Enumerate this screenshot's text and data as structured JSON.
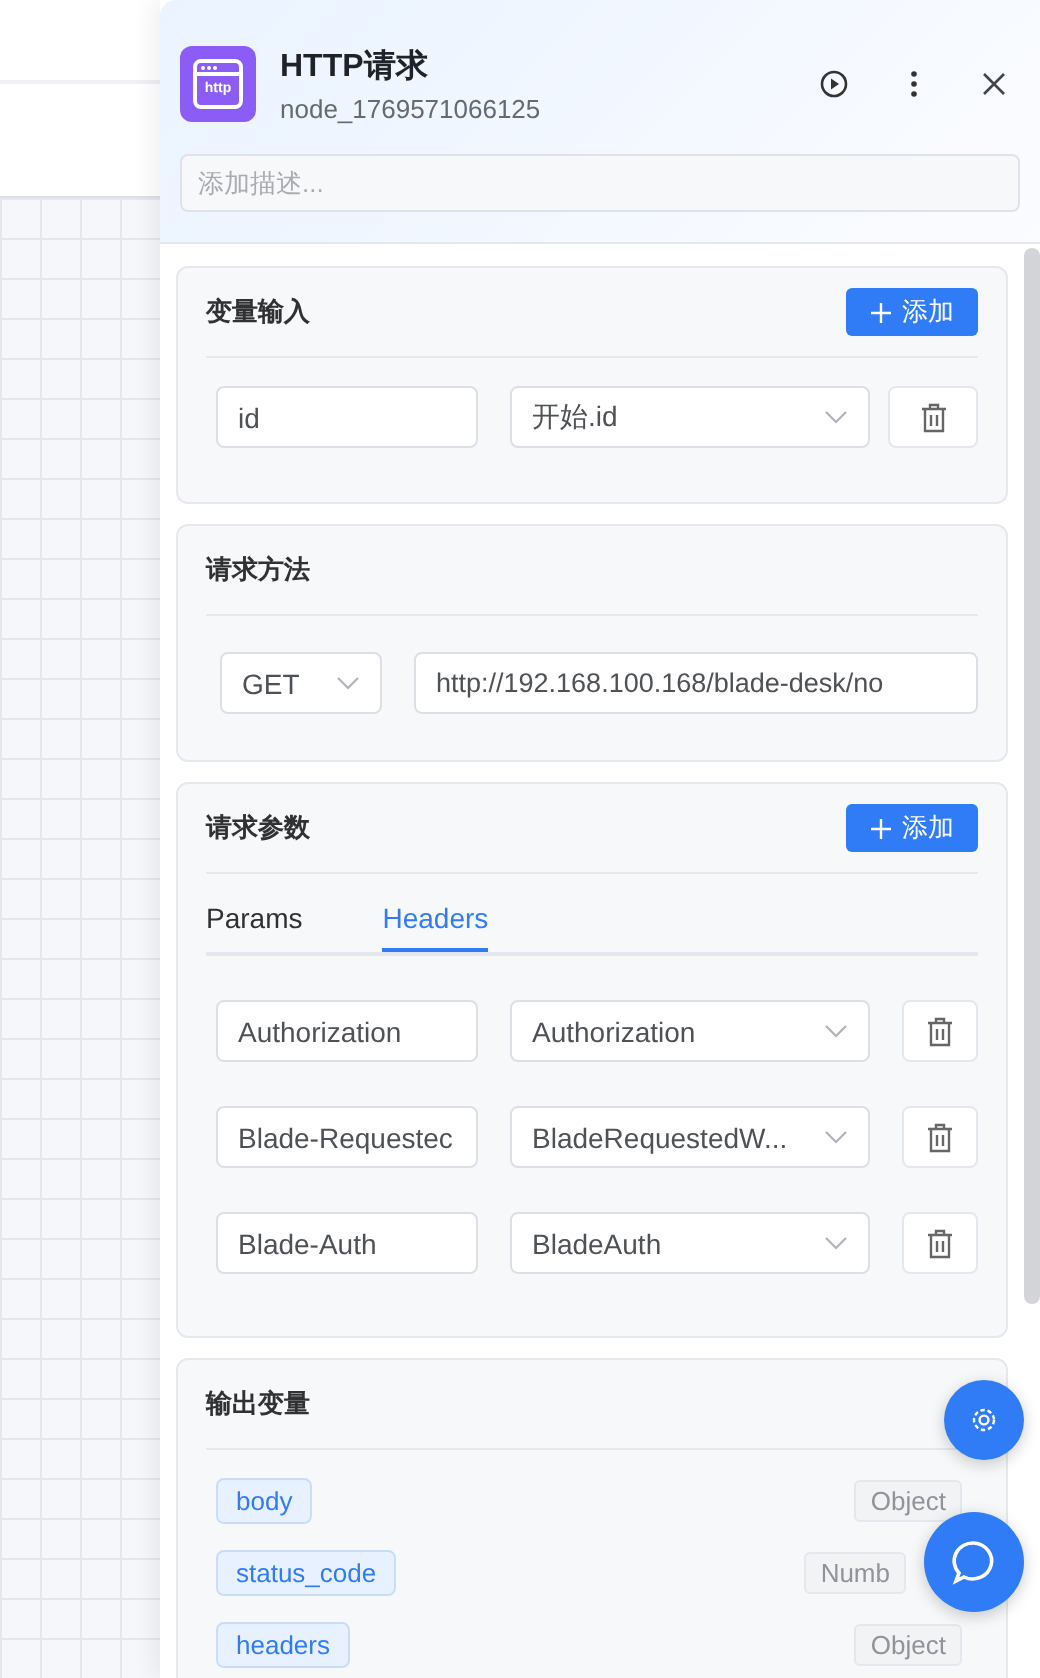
{
  "node": {
    "title": "HTTP请求",
    "id": "node_1769571066125",
    "icon_text": "http",
    "description": {
      "placeholder": "添加描述..."
    }
  },
  "sections": [
    {
      "kind": "inputs",
      "title": "变量输入",
      "add_label": "添加",
      "rows": [
        {
          "name": "id",
          "value": "开始.id"
        }
      ]
    },
    {
      "kind": "method",
      "title": "请求方法",
      "method": "GET",
      "url": "http://192.168.100.168/blade-desk/no"
    },
    {
      "kind": "params",
      "title": "请求参数",
      "add_label": "添加",
      "tabs": [
        {
          "label": "Params",
          "selected": false
        },
        {
          "label": "Headers",
          "selected": true
        }
      ],
      "rows": [
        {
          "name": "Authorization",
          "value": "Authorization"
        },
        {
          "name": "Blade-Requestec",
          "value": "BladeRequestedW..."
        },
        {
          "name": "Blade-Auth",
          "value": "BladeAuth"
        }
      ]
    },
    {
      "kind": "outputs",
      "title": "输出变量",
      "vars": [
        {
          "name": "body",
          "type": "Object"
        },
        {
          "name": "status_code",
          "type": "Numb"
        },
        {
          "name": "headers",
          "type": "Object"
        }
      ]
    }
  ]
}
